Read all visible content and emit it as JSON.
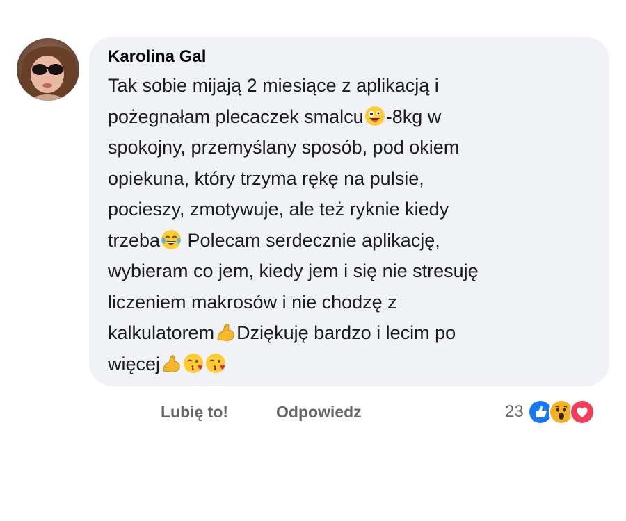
{
  "comment": {
    "author": "Karolina Gal",
    "lines": [
      [
        "Tak sobie mijają 2 miesiące z aplikacją i"
      ],
      [
        "pożegnałam plecaczek smalcu",
        "-8kg w"
      ],
      [
        "spokojny,  przemyślany sposób, pod okiem"
      ],
      [
        "opiekuna, który trzyma  rękę na pulsie,"
      ],
      [
        "pocieszy, zmotywuje, ale też ryknie kiedy"
      ],
      [
        "trzeba",
        " Polecam serdecznie aplikację,"
      ],
      [
        "wybieram co jem, kiedy jem i się nie stresuję"
      ],
      [
        "liczeniem makrosów i nie chodzę z"
      ],
      [
        "kalkulatorem",
        "Dziękuję bardzo i lecim po"
      ],
      [
        "więcej"
      ]
    ],
    "emojis": {
      "line2": "zany-face-emoji",
      "line6": "tears-of-joy-emoji",
      "line9": "flexed-biceps-emoji",
      "line10": [
        "flexed-biceps-emoji",
        "kissing-heart-emoji",
        "kissing-heart-emoji"
      ]
    }
  },
  "actions": {
    "like_label": "Lubię to!",
    "reply_label": "Odpowiedz"
  },
  "reactions": {
    "count": "23",
    "icons": [
      "like-reaction-icon",
      "wow-reaction-icon",
      "love-reaction-icon"
    ],
    "colors": {
      "like": "#1877f2",
      "wow": "#f7b125",
      "love": "#f33e58"
    }
  },
  "colors": {
    "bubble": "#f0f2f5",
    "text": "#1c1c1c",
    "muted": "#65676b"
  }
}
